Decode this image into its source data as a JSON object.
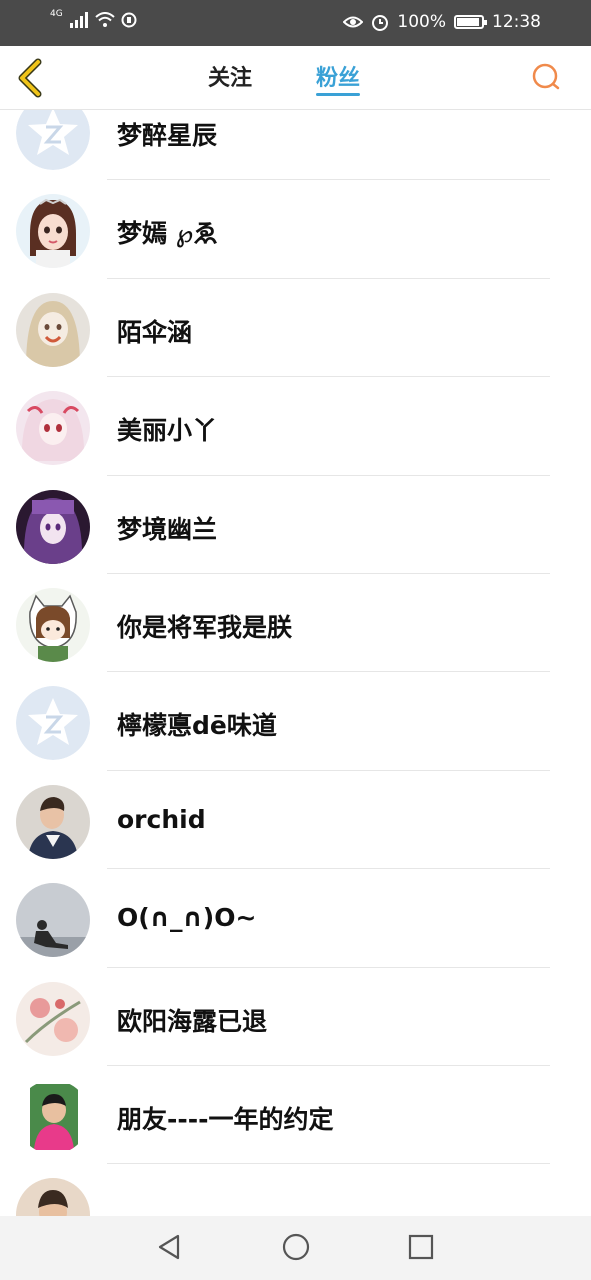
{
  "status_bar": {
    "network": "4G",
    "battery_percent": "100%",
    "battery_level": 0.85,
    "time": "12:38"
  },
  "header": {
    "tabs": [
      {
        "label": "关注"
      },
      {
        "label": "粉丝",
        "active": true
      }
    ]
  },
  "accent_color": "#3aa1d6",
  "back_icon_color": "#f0c419",
  "followers": [
    {
      "name": "梦醉星辰",
      "avatar": "default-qq-avatar"
    },
    {
      "name": "梦嫣 ℘ゑ",
      "avatar": "anime-girl-avatar"
    },
    {
      "name": "陌伞涵",
      "avatar": "blonde-girl-avatar"
    },
    {
      "name": "美丽小丫",
      "avatar": "pink-anime-avatar"
    },
    {
      "name": "梦境幽兰",
      "avatar": "purple-anime-avatar"
    },
    {
      "name": "你是将军我是朕",
      "avatar": "cat-hood-girl-avatar"
    },
    {
      "name": "檸檬悳dē味道",
      "avatar": "default-qq-avatar"
    },
    {
      "name": "orchid",
      "avatar": "man-photo-avatar"
    },
    {
      "name": "O(∩_∩)O~",
      "avatar": "sitting-person-photo-avatar"
    },
    {
      "name": "欧阳海露已退",
      "avatar": "flower-painting-avatar"
    },
    {
      "name": "朋友----一年的约定",
      "avatar": "child-photo-avatar"
    },
    {
      "name": "",
      "avatar": "boy-photo-avatar"
    }
  ]
}
